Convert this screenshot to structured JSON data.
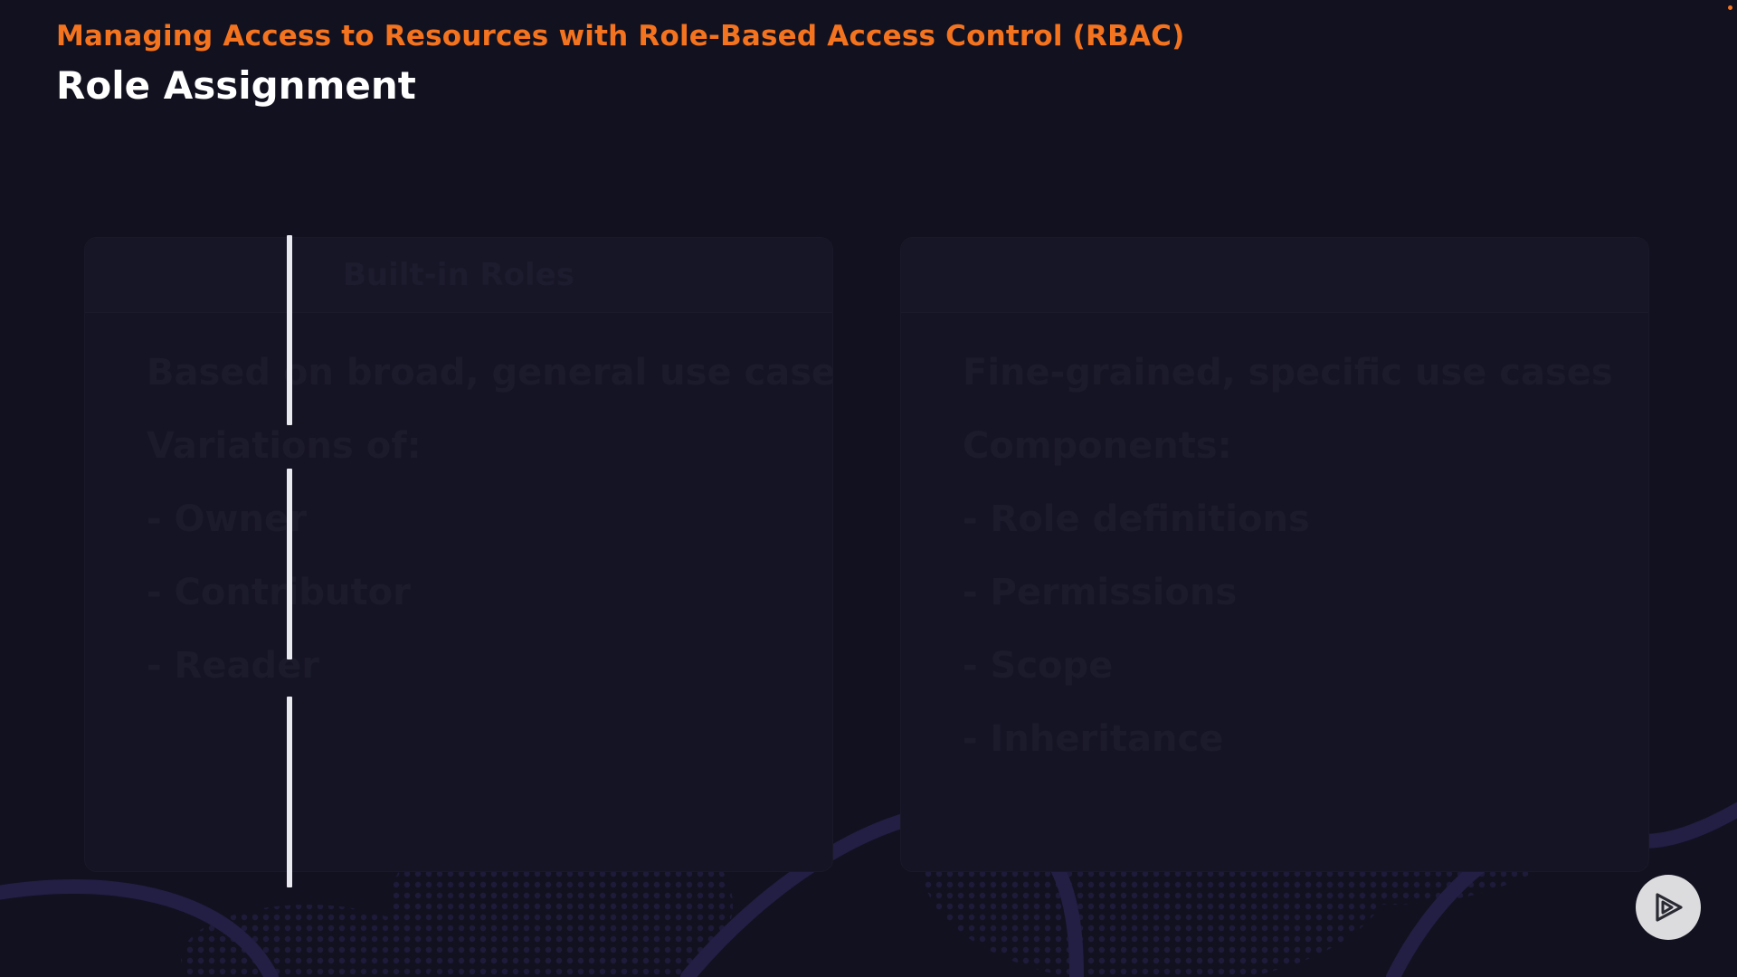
{
  "header": {
    "course_title": "Managing Access to Resources with Role-Based Access Control (RBAC)",
    "slide_title": "Role Assignment"
  },
  "panels": {
    "left": {
      "heading": "Built-in Roles",
      "lines": [
        "Based on broad, general use cases",
        "Variations of:",
        "- Owner",
        "- Contributor",
        "- Reader"
      ]
    },
    "right": {
      "heading": "",
      "lines": [
        "Fine-grained, specific use cases",
        "Components:",
        "- Role definitions",
        "- Permissions",
        "- Scope",
        "- Inheritance"
      ]
    }
  },
  "player": {
    "play_icon": "play-logo-icon"
  },
  "colors": {
    "background": "#12111f",
    "accent": "#f4731f",
    "title": "#ffffff",
    "wipe_bar": "#e9e9f0",
    "decor": "#221e44"
  }
}
